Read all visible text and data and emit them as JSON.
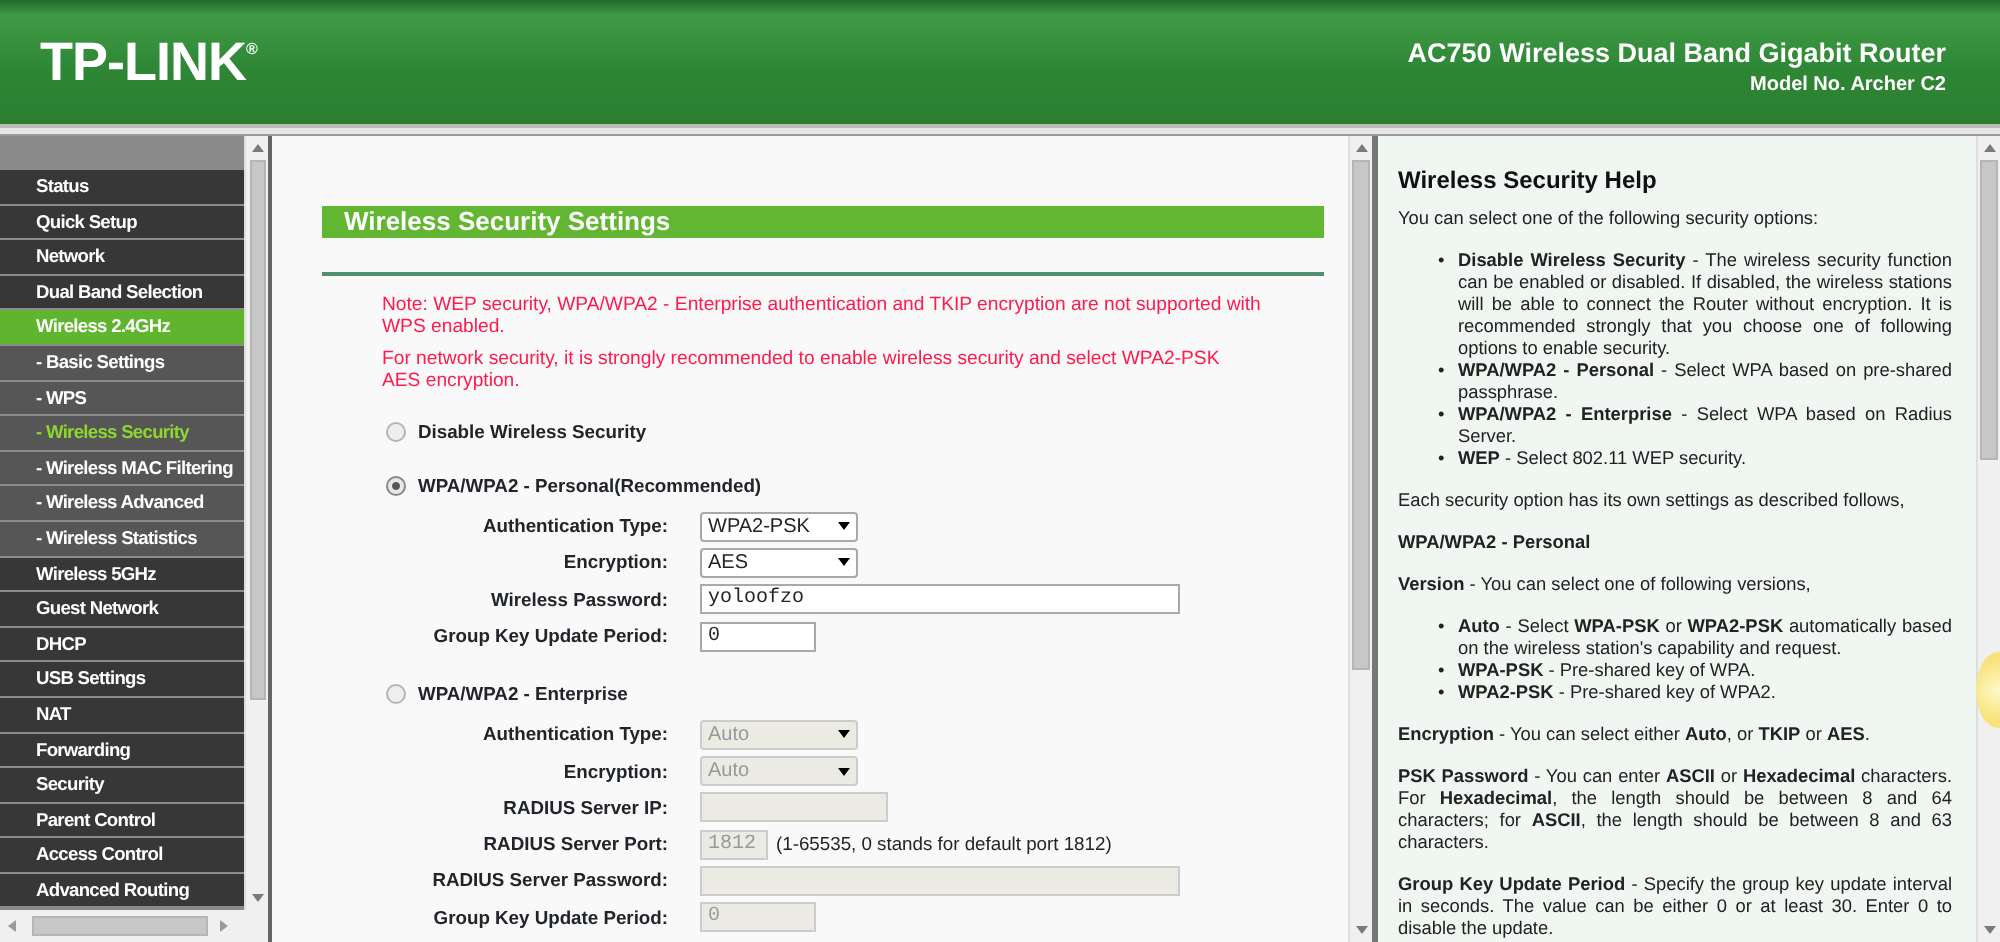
{
  "header": {
    "logo": "TP-LINK",
    "logo_mark": "®",
    "product": "AC750 Wireless Dual Band Gigabit Router",
    "model": "Model No. Archer C2"
  },
  "sidebar": {
    "items": [
      {
        "label": "Status",
        "kind": "main",
        "selected": false
      },
      {
        "label": "Quick Setup",
        "kind": "main",
        "selected": false
      },
      {
        "label": "Network",
        "kind": "main",
        "selected": false
      },
      {
        "label": "Dual Band Selection",
        "kind": "main",
        "selected": false
      },
      {
        "label": "Wireless 2.4GHz",
        "kind": "main",
        "selected": true
      },
      {
        "label": "- Basic Settings",
        "kind": "sub",
        "selected": false
      },
      {
        "label": "- WPS",
        "kind": "sub",
        "selected": false
      },
      {
        "label": "- Wireless Security",
        "kind": "sub",
        "selected": true
      },
      {
        "label": "- Wireless MAC Filtering",
        "kind": "sub",
        "selected": false
      },
      {
        "label": "- Wireless Advanced",
        "kind": "sub",
        "selected": false
      },
      {
        "label": "- Wireless Statistics",
        "kind": "sub",
        "selected": false
      },
      {
        "label": "Wireless 5GHz",
        "kind": "main",
        "selected": false
      },
      {
        "label": "Guest Network",
        "kind": "main",
        "selected": false
      },
      {
        "label": "DHCP",
        "kind": "main",
        "selected": false
      },
      {
        "label": "USB Settings",
        "kind": "main",
        "selected": false
      },
      {
        "label": "NAT",
        "kind": "main",
        "selected": false
      },
      {
        "label": "Forwarding",
        "kind": "main",
        "selected": false
      },
      {
        "label": "Security",
        "kind": "main",
        "selected": false
      },
      {
        "label": "Parent Control",
        "kind": "main",
        "selected": false
      },
      {
        "label": "Access Control",
        "kind": "main",
        "selected": false
      },
      {
        "label": "Advanced Routing",
        "kind": "main",
        "selected": false
      }
    ]
  },
  "main": {
    "title": "Wireless Security Settings",
    "notes": [
      "Note: WEP security, WPA/WPA2 - Enterprise authentication and TKIP encryption are not supported with WPS enabled.",
      "For network security, it is strongly recommended to enable wireless security and select WPA2-PSK AES encryption."
    ],
    "options": [
      {
        "label": "Disable Wireless Security",
        "selected": false
      },
      {
        "label": "WPA/WPA2 - Personal(Recommended)",
        "selected": true,
        "fields": [
          {
            "label": "Authentication Type:",
            "kind": "select",
            "value": "WPA2-PSK",
            "disabled": false
          },
          {
            "label": "Encryption:",
            "kind": "select",
            "value": "AES",
            "disabled": false
          },
          {
            "label": "Wireless Password:",
            "kind": "wide",
            "value": "yoloofzo",
            "disabled": false
          },
          {
            "label": "Group Key Update Period:",
            "kind": "short",
            "value": "0",
            "disabled": false
          }
        ]
      },
      {
        "label": "WPA/WPA2 - Enterprise",
        "selected": false,
        "fields": [
          {
            "label": "Authentication Type:",
            "kind": "select",
            "value": "Auto",
            "disabled": true
          },
          {
            "label": "Encryption:",
            "kind": "select",
            "value": "Auto",
            "disabled": true
          },
          {
            "label": "RADIUS Server IP:",
            "kind": "address",
            "disabled": true
          },
          {
            "label": "RADIUS Server Port:",
            "kind": "port",
            "value": "1812",
            "hint": "(1-65535, 0 stands for default port 1812)",
            "disabled": true
          },
          {
            "label": "RADIUS Server Password:",
            "kind": "wide",
            "disabled": true
          },
          {
            "label": "Group Key Update Period:",
            "kind": "short",
            "value": "0",
            "disabled": true
          }
        ]
      }
    ]
  },
  "help": {
    "title": "Wireless Security Help",
    "blocks": [
      {
        "kind": "paragraph",
        "text": "You can select one of the following security options:"
      },
      {
        "kind": "list",
        "bullet": "•",
        "items": [
          "**Disable Wireless Security** - The wireless security function can be enabled or disabled. If disabled, the wireless stations will be able to connect the Router without encryption. It is recommended strongly that you choose one of following options to enable security.",
          "**WPA/WPA2 - Personal** - Select WPA based on pre-shared passphrase.",
          "**WPA/WPA2 - Enterprise** - Select WPA based on Radius Server.",
          "**WEP** - Select 802.11 WEP security."
        ]
      },
      {
        "kind": "paragraph",
        "text": "Each security option has its own settings as described follows,"
      },
      {
        "kind": "heading",
        "text": "WPA/WPA2 - Personal"
      },
      {
        "kind": "paragraph",
        "text": "**Version** -  You can select one of following versions,"
      },
      {
        "kind": "list",
        "bullet": "•",
        "items": [
          "**Auto** - Select **WPA-PSK** or **WPA2-PSK** automatically based on the wireless station's capability and request.",
          "**WPA-PSK** - Pre-shared key of WPA.",
          "**WPA2-PSK** - Pre-shared key of WPA2."
        ]
      },
      {
        "kind": "paragraph",
        "text": "**Encryption** - You can select either **Auto**, or **TKIP** or **AES**."
      },
      {
        "kind": "paragraph",
        "text": "**PSK Password** - You can enter **ASCII** or **Hexadecimal** characters. For **Hexadecimal**, the length should be between 8 and 64 characters; for **ASCII**, the length should be between 8 and 63 characters."
      },
      {
        "kind": "paragraph",
        "text": "**Group Key Update Period** - Specify the group key update interval in seconds. The value can be either 0 or at least 30. Enter 0 to disable the update."
      }
    ]
  }
}
